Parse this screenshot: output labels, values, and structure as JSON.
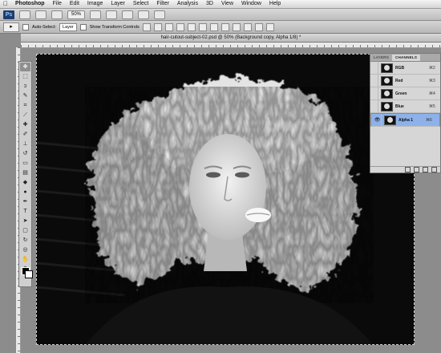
{
  "menubar": {
    "apple": "",
    "items": [
      "Photoshop",
      "File",
      "Edit",
      "Image",
      "Layer",
      "Select",
      "Filter",
      "Analysis",
      "3D",
      "View",
      "Window",
      "Help"
    ]
  },
  "appbar": {
    "logo": "Ps",
    "zoom": "50%"
  },
  "options": {
    "auto_select_label": "Auto-Select:",
    "auto_select_value": "Layer",
    "show_transform_label": "Show Transform Controls"
  },
  "document": {
    "title": "hair-cutout-subject-02.psd @ 50% (Background copy, Alpha 1/8) *"
  },
  "channels_panel": {
    "tabs": [
      "LAYERS",
      "CHANNELS"
    ],
    "active_tab": "CHANNELS",
    "channels": [
      {
        "name": "RGB",
        "shortcut": "⌘2"
      },
      {
        "name": "Red",
        "shortcut": "⌘3"
      },
      {
        "name": "Green",
        "shortcut": "⌘4"
      },
      {
        "name": "Blue",
        "shortcut": "⌘5"
      },
      {
        "name": "Alpha 1",
        "shortcut": "⌘6",
        "selected": true
      }
    ]
  },
  "colors": {
    "foreground": "#000000",
    "background": "#ffffff",
    "selection": "#8db2ea"
  }
}
